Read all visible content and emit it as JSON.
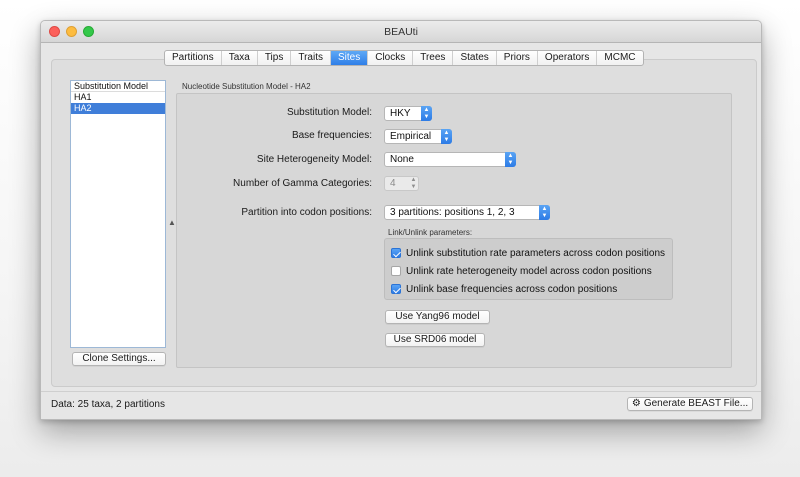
{
  "window": {
    "title": "BEAUti"
  },
  "tabs": [
    {
      "label": "Partitions",
      "active": false
    },
    {
      "label": "Taxa",
      "active": false
    },
    {
      "label": "Tips",
      "active": false
    },
    {
      "label": "Traits",
      "active": false
    },
    {
      "label": "Sites",
      "active": true
    },
    {
      "label": "Clocks",
      "active": false
    },
    {
      "label": "Trees",
      "active": false
    },
    {
      "label": "States",
      "active": false
    },
    {
      "label": "Priors",
      "active": false
    },
    {
      "label": "Operators",
      "active": false
    },
    {
      "label": "MCMC",
      "active": false
    }
  ],
  "partition_list": {
    "items": [
      {
        "label": "Substitution Model",
        "selected": false
      },
      {
        "label": "HA1",
        "selected": false
      },
      {
        "label": "HA2",
        "selected": true
      }
    ],
    "clone_button": "Clone Settings..."
  },
  "model": {
    "section_title": "Nucleotide Substitution Model - HA2",
    "fields": {
      "substitution_model": {
        "label": "Substitution Model:",
        "value": "HKY"
      },
      "base_frequencies": {
        "label": "Base frequencies:",
        "value": "Empirical"
      },
      "site_heterogeneity": {
        "label": "Site Heterogeneity Model:",
        "value": "None"
      },
      "gamma_categories": {
        "label": "Number of Gamma Categories:",
        "value": "4"
      },
      "codon_partition": {
        "label": "Partition into codon positions:",
        "value": "3 partitions: positions 1, 2, 3"
      }
    },
    "link_unlink": {
      "title": "Link/Unlink parameters:",
      "options": [
        {
          "label": "Unlink substitution rate parameters across codon positions",
          "checked": true
        },
        {
          "label": "Unlink rate heterogeneity model across codon positions",
          "checked": false
        },
        {
          "label": "Unlink base frequencies across codon positions",
          "checked": true
        }
      ]
    },
    "buttons": {
      "yang96": "Use Yang96 model",
      "srd06": "Use SRD06 model"
    }
  },
  "status": {
    "text": "Data: 25 taxa, 2 partitions",
    "generate_button": "Generate BEAST File..."
  },
  "icons": {
    "gear": "gear-icon",
    "combo_arrows": "chevron-updown-icon",
    "splitter": "splitter-arrow-icon"
  },
  "colors": {
    "accent": "#3f7ed9",
    "close": "#fc605b",
    "minimize": "#fdbc40",
    "maximize": "#34c84a"
  }
}
